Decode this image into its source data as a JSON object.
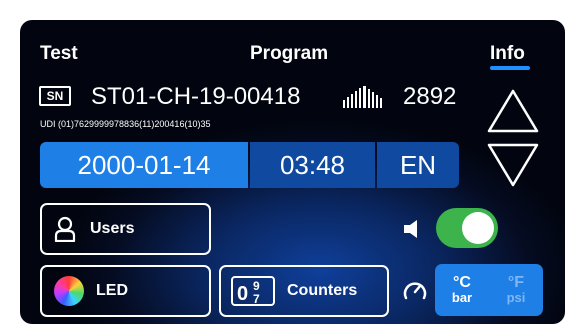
{
  "tabs": {
    "test": "Test",
    "program": "Program",
    "info": "Info",
    "active": "Info"
  },
  "device": {
    "sn_badge": "SN",
    "serial": "ST01-CH-19-00418",
    "count": "2892",
    "udi": "UDI (01)7629999978836(11)200416(10)35"
  },
  "datetime": {
    "date": "2000-01-14",
    "time": "03:48",
    "language": "EN"
  },
  "buttons": {
    "users": "Users",
    "led": "LED",
    "counters": "Counters"
  },
  "sound": {
    "enabled": true
  },
  "units": {
    "selected": {
      "temp": "°C",
      "pressure": "bar"
    },
    "alternate": {
      "temp": "°F",
      "pressure": "psi"
    }
  },
  "colors": {
    "accent": "#1e7fe6",
    "toggle_on": "#3cb44b",
    "dim_unit": "#7fb6f3"
  },
  "icons": [
    "barcode-icon",
    "up-arrow-icon",
    "down-arrow-icon",
    "user-icon",
    "color-wheel-icon",
    "counter-digits-icon",
    "speaker-icon",
    "gauge-icon"
  ]
}
